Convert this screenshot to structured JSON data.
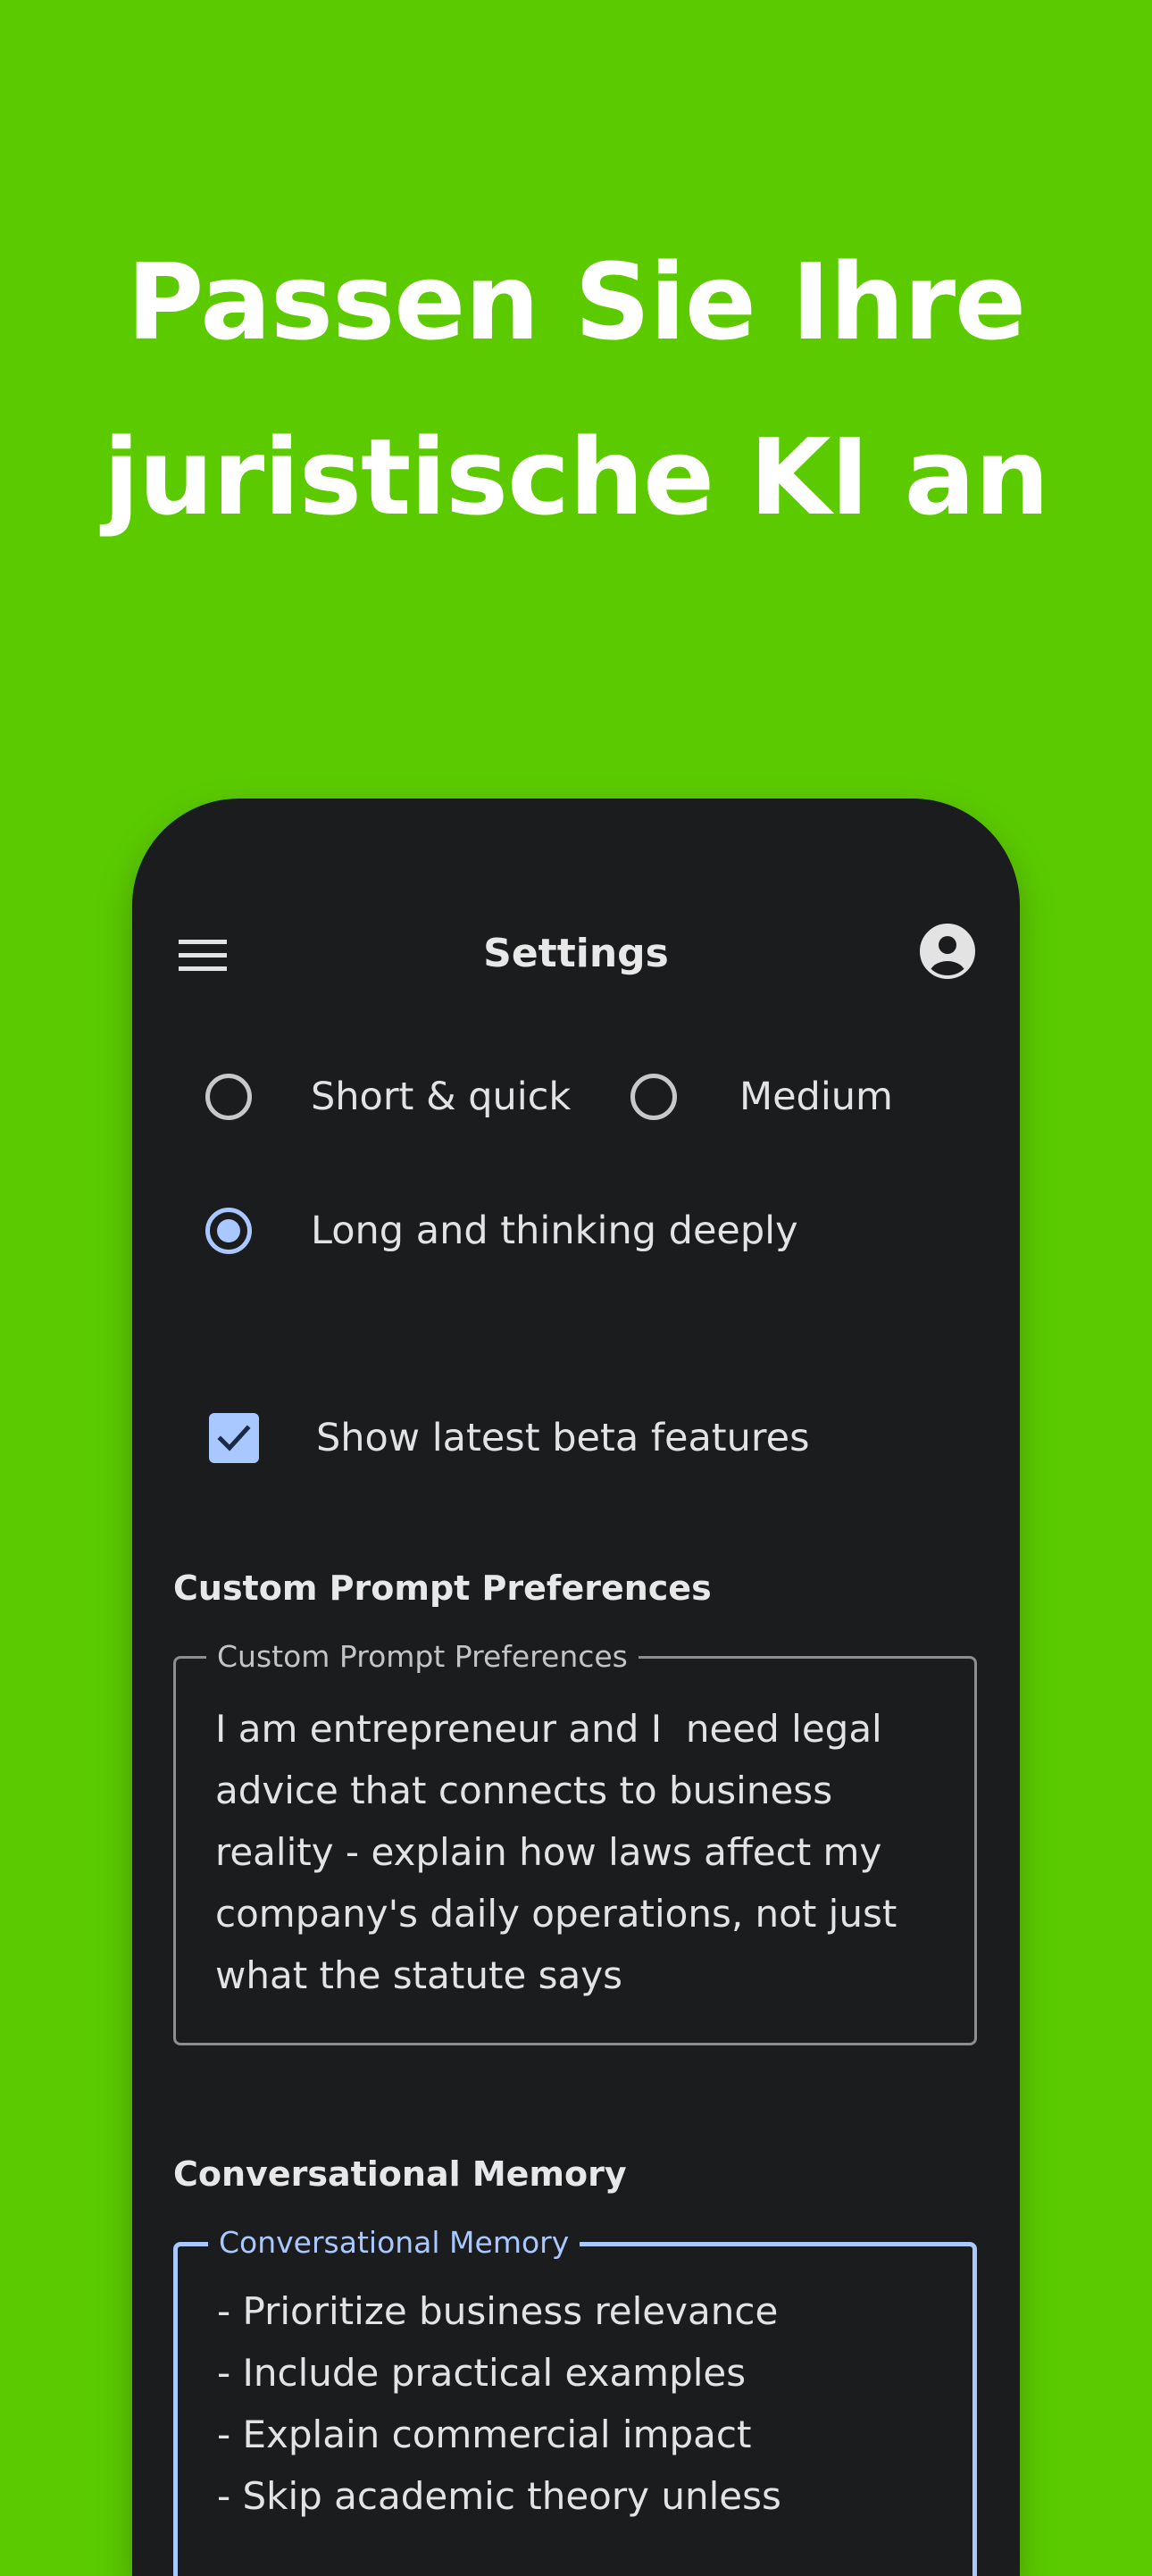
{
  "headline": {
    "line1": "Passen Sie Ihre",
    "line2": "juristische KI an"
  },
  "appbar": {
    "title": "Settings",
    "menu_icon": "hamburger-menu-icon",
    "account_icon": "account-circle-icon"
  },
  "response_length": {
    "options": [
      {
        "label": "Short & quick",
        "selected": false
      },
      {
        "label": "Medium",
        "selected": false
      },
      {
        "label": "Long and thinking deeply",
        "selected": true
      }
    ]
  },
  "beta": {
    "label": "Show latest beta features",
    "checked": true
  },
  "custom_prompt": {
    "heading": "Custom Prompt Preferences",
    "legend": "Custom Prompt Preferences",
    "value": "I am entrepreneur and I  need legal\nadvice that connects to business\nreality - explain how laws affect my\ncompany's daily operations, not just\nwhat the statute says"
  },
  "memory": {
    "heading": "Conversational Memory",
    "legend": "Conversational Memory",
    "value": "- Prioritize business relevance\n- Include practical examples\n- Explain commercial impact\n- Skip academic theory unless"
  },
  "colors": {
    "background": "#5bcb00",
    "surface": "#1b1c1e",
    "accent": "#a8c8ff",
    "text": "#e3e3e3"
  }
}
